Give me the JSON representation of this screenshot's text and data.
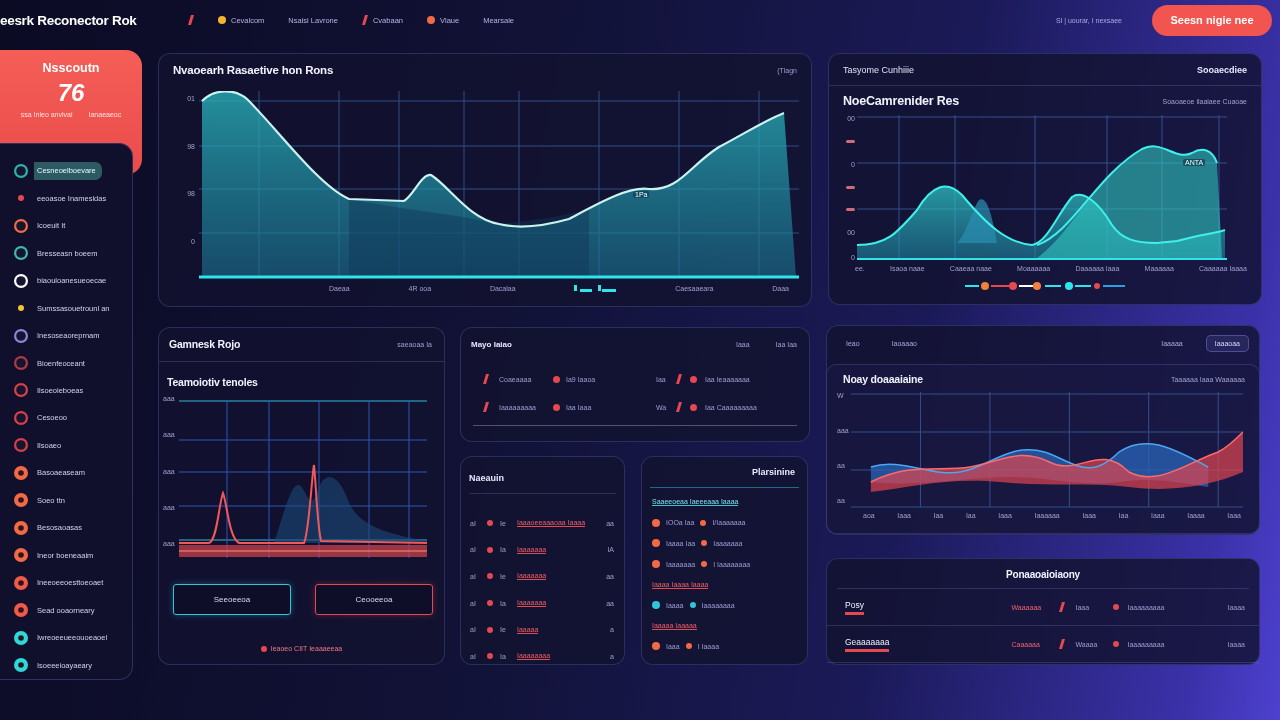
{
  "header": {
    "logo": "eesrk Reconector Rok",
    "nav": [
      {
        "kind": "mark",
        "color": "#e5484f"
      },
      {
        "kind": "dot",
        "color": "#f4b52c",
        "label": "Cevalcom"
      },
      {
        "kind": "text",
        "label": "Nsaisi Lavrone"
      },
      {
        "kind": "mark",
        "color": "#e5484f",
        "label": "Cvabaan"
      },
      {
        "kind": "dot",
        "color": "#f26a45",
        "label": "Vlaue"
      },
      {
        "kind": "text",
        "label": "Mearsaie"
      }
    ],
    "account": "Sl | uourar, I nexsaee",
    "cta_button": "Seesn nigie nee"
  },
  "score_card": {
    "title": "Nsscoutn",
    "value": "76",
    "caption_left": "ssa Inleo anvivai",
    "caption_right": "Ianaeaeoc"
  },
  "sidebar": {
    "items": [
      {
        "label": "Cesneoelboevare",
        "kind": "ring",
        "color": "#2bb5a8",
        "selected": true
      },
      {
        "label": "eeoasoe Inamesidas",
        "kind": "dot",
        "color": "#e5484f",
        "selected": false
      },
      {
        "label": "Icoeuit It",
        "kind": "ring",
        "color": "#f26a45",
        "selected": false
      },
      {
        "label": "Bresseasn boeem",
        "kind": "ring",
        "color": "#3fb8b0",
        "selected": false
      },
      {
        "label": "biaouloanesueoecae",
        "kind": "ring",
        "color": "#ffffff",
        "selected": false
      },
      {
        "label": "Sumssasouetrounl an",
        "kind": "dot",
        "color": "#f4c42c",
        "selected": false
      },
      {
        "label": "Inesoseaoreprnam",
        "kind": "ring",
        "color": "#8a86d8",
        "selected": false
      },
      {
        "label": "Bioenfeoceant",
        "kind": "ring",
        "color": "#b03a44",
        "selected": false
      },
      {
        "label": "Ilsoeoieboeas",
        "kind": "ring",
        "color": "#d8404a",
        "selected": false
      },
      {
        "label": "Cesoeoo",
        "kind": "ring",
        "color": "#d8404a",
        "selected": false
      },
      {
        "label": "Ilsoaeo",
        "kind": "ring",
        "color": "#d8404a",
        "selected": false
      },
      {
        "label": "Basoaeaseam",
        "kind": "filled",
        "color": "#f26a45",
        "selected": false
      },
      {
        "label": "Soeo ttn",
        "kind": "filled",
        "color": "#f26a45",
        "selected": false
      },
      {
        "label": "Besosaoasas",
        "kind": "filled",
        "color": "#f26a45",
        "selected": false
      },
      {
        "label": "Ineor boeneaaim",
        "kind": "filled",
        "color": "#f26a45",
        "selected": false
      },
      {
        "label": "Ineeoeeoesttoeoaet",
        "kind": "filled",
        "color": "#f05a48",
        "selected": false
      },
      {
        "label": "Sead ooaorneary",
        "kind": "filled",
        "color": "#f05a48",
        "selected": false
      },
      {
        "label": "Iwreoeeueeouoeaoel",
        "kind": "filled",
        "color": "#2fd8d8",
        "selected": false
      },
      {
        "label": "Isoeeeioayaeary",
        "kind": "filled",
        "color": "#2fd8d8",
        "selected": false
      }
    ]
  },
  "main_chart": {
    "title": "Nvaoearh Rasaetive hon Rons",
    "range": "(Tlagn",
    "y_labels": [
      "01",
      "98",
      "98",
      "0"
    ],
    "point_label": "1Pa",
    "x_labels": [
      "Daeaa",
      "4R ooa",
      "Dacalaa",
      "Caesaaeara",
      "Daaa"
    ]
  },
  "trend_card": {
    "title": "Tasyome Cunhiiie",
    "action": "Sooaecdiee",
    "chart_title": "NoeCamrenider Res",
    "chart_note": "Soaoaeoe ilaaiaee Cuaoae",
    "y_labels": [
      "00",
      "0",
      "00",
      "0"
    ],
    "peak_label": "ANTA",
    "x_labels": [
      "ee.",
      "Isaoa naae",
      "Caaeaa naae",
      "Moaaaaaa",
      "Daaaaaa Iaaa",
      "Maaaaaa",
      "Caaaaaa Iaaaa"
    ]
  },
  "response_card": {
    "title": "Gamnesk Rojo",
    "note": "saeaoaa Ia",
    "chart_title": "Teamoiotiv tenoles",
    "y_labels": [
      "aaa",
      "aaa",
      "aaa",
      "aaa",
      "aaa"
    ],
    "buttons": [
      {
        "label": "Seeoeeoa",
        "color": "#2fc6d8"
      },
      {
        "label": "Ceooeeoa",
        "color": "#e5484f"
      }
    ],
    "footer": "Ieaoeo CIIT Ieaaaeeaa"
  },
  "mix_card": {
    "title": "Mayo Iaiao",
    "header_labels": [
      "Iaaa",
      "Iaa Iaa"
    ],
    "rows": [
      {
        "cells": [
          "Coaeaaaa",
          "Ia9 Iaaoa",
          "Iaa",
          "Iaa Ieaaaaaaa"
        ]
      },
      {
        "cells": [
          "Iaaaaaaaaa",
          "Iaa Iaaa",
          "Wa",
          "Iaa Caaaaaaaaa"
        ]
      }
    ]
  },
  "list_card": {
    "title": "Naeauin",
    "rows": [
      {
        "code": "aI",
        "tag": "Ie",
        "text": "Iaaaoeeaaaoaa Iaaaa",
        "value": "aa"
      },
      {
        "code": "aI",
        "tag": "Ia",
        "text": "Iaaaaaaa",
        "value": "IA"
      },
      {
        "code": "aI",
        "tag": "Ie",
        "text": "Iaaaaaaa",
        "value": "aa"
      },
      {
        "code": "aI",
        "tag": "Ia",
        "text": "Iaaaaaaa",
        "value": "aa"
      },
      {
        "code": "aI",
        "tag": "Ie",
        "text": "Iaaaaa",
        "value": "a"
      },
      {
        "code": "aI",
        "tag": "Ia",
        "text": "Iaaaaaaaa",
        "value": "a"
      }
    ]
  },
  "plan_card": {
    "title": "Plarsinine",
    "rows": [
      {
        "kind": "heading",
        "text": "Saaeeoeaa Iaeeeaaa Iaaaa"
      },
      {
        "kind": "item",
        "color": "#f26a45",
        "label": "IOOa Iaa",
        "value": "I/Iaaaaaaa"
      },
      {
        "kind": "item",
        "color": "#f26a45",
        "label": "Iaaaa Iaa",
        "value": "Iaaaaaaa"
      },
      {
        "kind": "item",
        "color": "#f26a45",
        "label": "Iaaaaaaa",
        "value": "I Iaaaaaaaa"
      },
      {
        "kind": "note",
        "text": "Iaaaa Iaaaa Iaaaa"
      },
      {
        "kind": "item",
        "color": "#2fc6d8",
        "label": "Iaaaa",
        "value": "Iaaaaaaaa"
      },
      {
        "kind": "note",
        "text": "Iaaaaa Iaaaaa"
      },
      {
        "kind": "item",
        "color": "#f26a45",
        "label": "Iaaa",
        "value": "I Iaaaa"
      }
    ]
  },
  "wave_card": {
    "tabs": [
      {
        "label": "Ieao",
        "selected": false
      },
      {
        "label": "Iaoaaao",
        "selected": false
      },
      {
        "label": "Iaaaaa",
        "selected": false
      },
      {
        "label": "Iaaaoaa",
        "selected": true
      }
    ],
    "chart_title": "Noay doaaaiaine",
    "chart_note": "Taaaaaa Iaaa Waaaaaa",
    "y_labels": [
      "W",
      "aaa",
      "aa",
      "aa"
    ],
    "x_labels": [
      "aoa",
      "Iaaa",
      "Iaa",
      "Iaa",
      "Iaaa",
      "Iaaaaaa",
      "Iaaa",
      "Iaa",
      "Iaaa",
      "Iaaaa",
      "Iaaa"
    ]
  },
  "summary_card": {
    "title": "Ponaaoaioiaony",
    "rows": [
      {
        "name": "Posy",
        "cells": [
          "Waaaaaa",
          "Iaaa",
          "Iaaaaaaaaa",
          "Iaaaa"
        ]
      },
      {
        "name": "Geaaaaaaa",
        "cells": [
          "Caaaaaa",
          "Waaaa",
          "Iaaaaaaaaa",
          "Iaaaa"
        ]
      }
    ]
  }
}
